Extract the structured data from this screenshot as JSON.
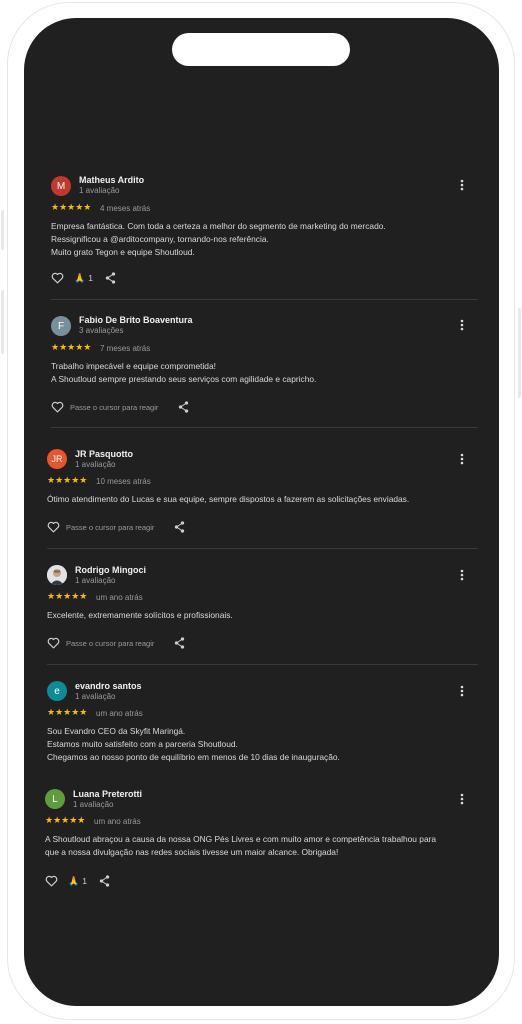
{
  "reviews": [
    {
      "avatar_letter": "M",
      "avatar_color": "#c0392b",
      "name": "Matheus Ardito",
      "count": "1 avaliação",
      "stars": "★★★★★",
      "date": "4 meses atrás",
      "text": "Empresa fantástica. Com toda a certeza a melhor do segmento de marketing do mercado.\nRessignificou a @arditocompany, tornando-nos referência.\nMuito grato Tegon e equipe Shoutloud.",
      "reaction_emoji": "🙏",
      "reaction_count": "1",
      "hint": ""
    },
    {
      "avatar_letter": "F",
      "avatar_color": "#78909c",
      "name": "Fabio De Brito Boaventura",
      "count": "3 avaliações",
      "stars": "★★★★★",
      "date": "7 meses atrás",
      "text": "Trabalho impecável e equipe comprometida!\nA Shoutloud sempre prestando seus serviços com agilidade e capricho.",
      "reaction_emoji": "",
      "reaction_count": "",
      "hint": "Passe o cursor para reagir"
    },
    {
      "avatar_letter": "JR",
      "avatar_color": "#e8552b",
      "name": "JR Pasquotto",
      "count": "1 avaliação",
      "stars": "★★★★★",
      "date": "10 meses atrás",
      "text": "Ótimo atendimento do Lucas e sua equipe, sempre dispostos a fazerem as solicitações enviadas.",
      "reaction_emoji": "",
      "reaction_count": "",
      "hint": "Passe o cursor para reagir"
    },
    {
      "avatar_letter": "",
      "avatar_color": "#d9d9d9",
      "name": "Rodrigo Mingoci",
      "count": "1 avaliação",
      "stars": "★★★★★",
      "date": "um ano atrás",
      "text": "Excelente, extremamente solícitos e profissionais.",
      "reaction_emoji": "",
      "reaction_count": "",
      "hint": "Passe o cursor para reagir"
    },
    {
      "avatar_letter": "e",
      "avatar_color": "#0e8c95",
      "name": "evandro santos",
      "count": "1 avaliação",
      "stars": "★★★★★",
      "date": "um ano atrás",
      "text": "Sou Evandro CEO da Skyfit Maringá.\nEstamos muito satisfeito com a parceria Shoutloud.\nChegamos ao nosso ponto de equilíbrio em menos de 10 dias de inauguração.",
      "reaction_emoji": "",
      "reaction_count": "",
      "hint": ""
    },
    {
      "avatar_letter": "L",
      "avatar_color": "#5d9e3a",
      "name": "Luana Preterotti",
      "count": "1 avaliação",
      "stars": "★★★★★",
      "date": "um ano atrás",
      "text": "A Shoutloud abraçou a causa da nossa ONG Pés Livres e com muito amor e competência trabalhou para\nque a nossa divulgação nas redes sociais tivesse um maior alcance. Obrigada!",
      "reaction_emoji": "🙏",
      "reaction_count": "1",
      "hint": ""
    }
  ]
}
